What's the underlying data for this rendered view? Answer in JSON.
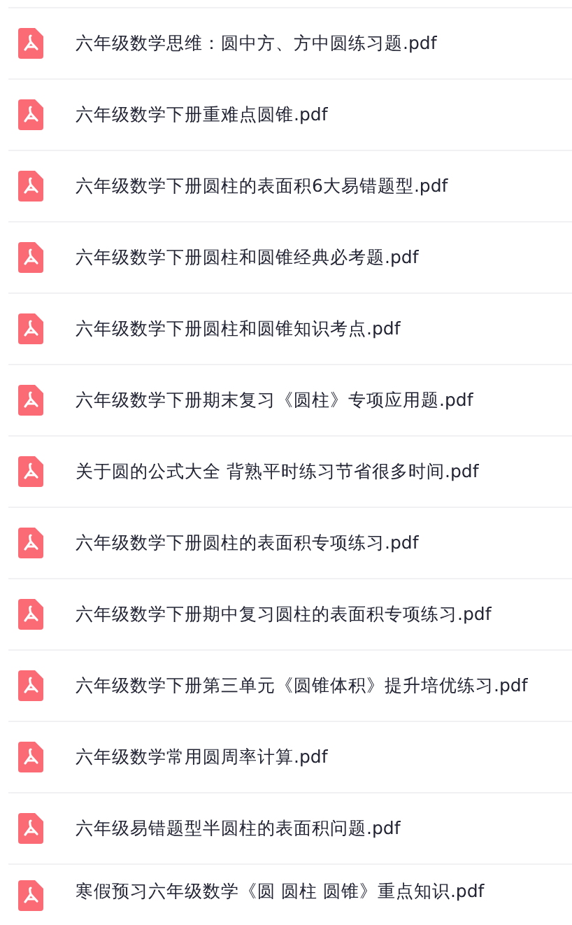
{
  "files": [
    {
      "name": "六年级数学思维：圆中方、方中圆练习题.pdf",
      "kind": "pdf"
    },
    {
      "name": "六年级数学下册重难点圆锥.pdf",
      "kind": "pdf"
    },
    {
      "name": "六年级数学下册圆柱的表面积6大易错题型.pdf",
      "kind": "pdf"
    },
    {
      "name": "六年级数学下册圆柱和圆锥经典必考题.pdf",
      "kind": "pdf"
    },
    {
      "name": "六年级数学下册圆柱和圆锥知识考点.pdf",
      "kind": "pdf"
    },
    {
      "name": "六年级数学下册期末复习《圆柱》专项应用题.pdf",
      "kind": "pdf"
    },
    {
      "name": "关于圆的公式大全 背熟平时练习节省很多时间.pdf",
      "kind": "pdf"
    },
    {
      "name": "六年级数学下册圆柱的表面积专项练习.pdf",
      "kind": "pdf"
    },
    {
      "name": "六年级数学下册期中复习圆柱的表面积专项练习.pdf",
      "kind": "pdf"
    },
    {
      "name": "六年级数学下册第三单元《圆锥体积》提升培优练习.pdf",
      "kind": "pdf"
    },
    {
      "name": "六年级数学常用圆周率计算.pdf",
      "kind": "pdf"
    },
    {
      "name": "六年级易错题型半圆柱的表面积问题.pdf",
      "kind": "pdf"
    },
    {
      "name": "寒假预习六年级数学《圆 圆柱 圆锥》重点知识.pdf",
      "kind": "pdf"
    }
  ]
}
